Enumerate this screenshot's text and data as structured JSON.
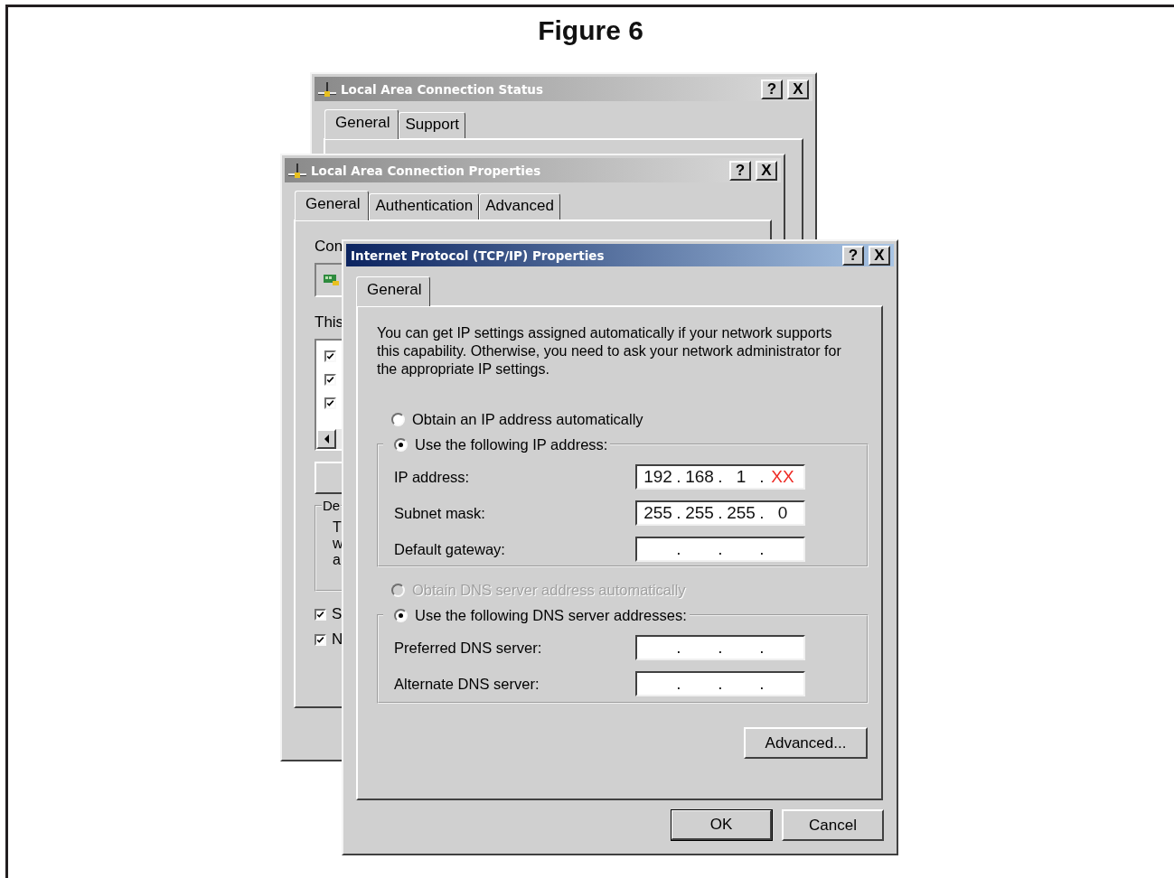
{
  "figure_title": "Figure 6",
  "status_window": {
    "title": "Local Area Connection Status",
    "active": false,
    "title_buttons": [
      {
        "kind": "help",
        "label": "?"
      },
      {
        "kind": "close",
        "label": "X"
      }
    ],
    "tabs": [
      {
        "label": "General",
        "selected": true
      },
      {
        "label": "Support",
        "selected": false
      }
    ]
  },
  "properties_window": {
    "title": "Local Area Connection Properties",
    "active": false,
    "title_buttons": [
      {
        "kind": "help",
        "label": "?"
      },
      {
        "kind": "close",
        "label": "X"
      }
    ],
    "tabs": [
      {
        "label": "General",
        "selected": true
      },
      {
        "label": "Authentication",
        "selected": false
      },
      {
        "label": "Advanced",
        "selected": false
      }
    ],
    "connect_label": "Con",
    "components_label": "This",
    "components": [
      {
        "checked": true
      },
      {
        "checked": true
      },
      {
        "checked": true
      }
    ],
    "description_label": "De",
    "description_lines": [
      "T",
      "w",
      "a"
    ],
    "options": [
      {
        "label": "S",
        "checked": true
      },
      {
        "label": "N",
        "checked": true
      }
    ]
  },
  "tcpip_window": {
    "title": "Internet Protocol (TCP/IP) Properties",
    "active": true,
    "title_buttons": [
      {
        "kind": "help",
        "label": "?"
      },
      {
        "kind": "close",
        "label": "X"
      }
    ],
    "tabs": [
      {
        "label": "General",
        "selected": true
      }
    ],
    "description": "You can get IP settings assigned automatically if your network supports this capability. Otherwise, you need to ask your network administrator for the appropriate IP settings.",
    "ip_auto_option": {
      "label": "Obtain an IP address automatically",
      "selected": false,
      "disabled": false
    },
    "ip_manual_option": {
      "label": "Use the following IP address:",
      "selected": true,
      "disabled": false
    },
    "ip_fields": [
      {
        "label": "IP address:",
        "octets": [
          {
            "text": "192",
            "highlighted": false
          },
          {
            "text": "168",
            "highlighted": false
          },
          {
            "text": "1",
            "highlighted": false
          },
          {
            "text": "XX",
            "highlighted": true
          }
        ],
        "dots": [
          ".",
          ".",
          "."
        ]
      },
      {
        "label": "Subnet mask:",
        "octets": [
          {
            "text": "255",
            "highlighted": false
          },
          {
            "text": "255",
            "highlighted": false
          },
          {
            "text": "255",
            "highlighted": false
          },
          {
            "text": "0",
            "highlighted": false
          }
        ],
        "dots": [
          ".",
          ".",
          "."
        ]
      },
      {
        "label": "Default gateway:",
        "dots": [
          ".",
          ".",
          "."
        ]
      }
    ],
    "dns_auto_option": {
      "label": "Obtain DNS server address automatically",
      "selected": false,
      "disabled": true
    },
    "dns_manual_option": {
      "label": "Use the following DNS server addresses:",
      "selected": true,
      "disabled": false
    },
    "dns_fields": [
      {
        "label": "Preferred DNS server:",
        "dots": [
          ".",
          ".",
          "."
        ]
      },
      {
        "label": "Alternate DNS server:",
        "dots": [
          ".",
          ".",
          "."
        ]
      }
    ],
    "advanced_button": "Advanced...",
    "buttons": [
      {
        "label": "OK",
        "default": true
      },
      {
        "label": "Cancel",
        "default": false
      }
    ]
  }
}
